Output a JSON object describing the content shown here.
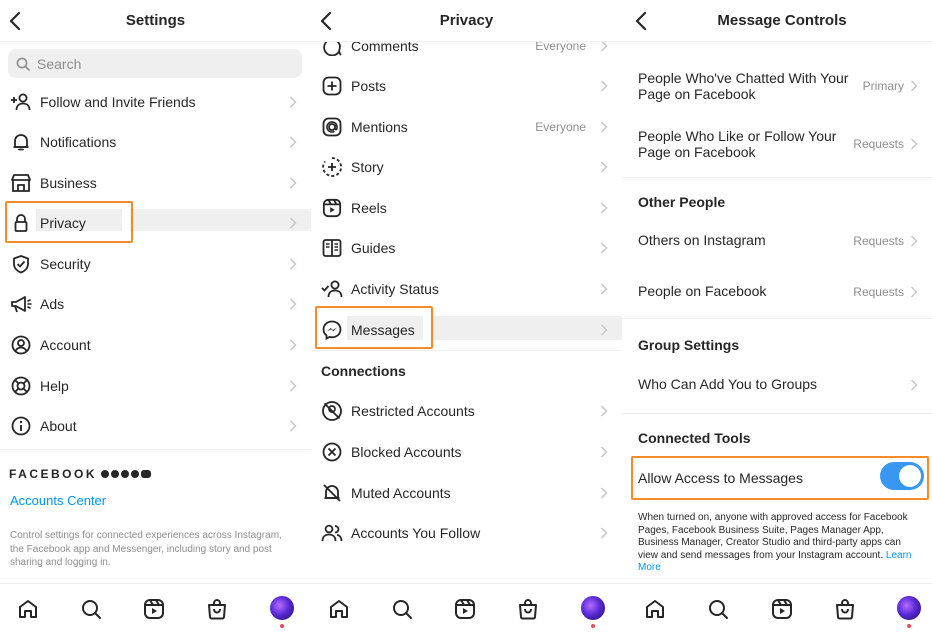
{
  "settings": {
    "title": "Settings",
    "search_placeholder": "Search",
    "items": [
      {
        "label": "Follow and Invite Friends",
        "icon": "add-person-icon"
      },
      {
        "label": "Notifications",
        "icon": "bell-icon"
      },
      {
        "label": "Business",
        "icon": "storefront-icon"
      },
      {
        "label": "Privacy",
        "icon": "lock-icon"
      },
      {
        "label": "Security",
        "icon": "shield-icon"
      },
      {
        "label": "Ads",
        "icon": "megaphone-icon"
      },
      {
        "label": "Account",
        "icon": "account-circle-icon"
      },
      {
        "label": "Help",
        "icon": "lifebuoy-icon"
      },
      {
        "label": "About",
        "icon": "info-icon"
      }
    ],
    "facebook_label": "FACEBOOK",
    "accounts_center": "Accounts Center",
    "note": "Control settings for connected experiences across Instagram, the Facebook app and Messenger, including story and post sharing and logging in."
  },
  "privacy": {
    "title": "Privacy",
    "items": [
      {
        "label": "Comments",
        "value": "Everyone",
        "icon": "comment-icon"
      },
      {
        "label": "Posts",
        "value": "",
        "icon": "plus-square-icon"
      },
      {
        "label": "Mentions",
        "value": "Everyone",
        "icon": "at-sign-icon"
      },
      {
        "label": "Story",
        "value": "",
        "icon": "story-plus-icon"
      },
      {
        "label": "Reels",
        "value": "",
        "icon": "reels-icon"
      },
      {
        "label": "Guides",
        "value": "",
        "icon": "guides-book-icon"
      },
      {
        "label": "Activity Status",
        "value": "",
        "icon": "activity-status-icon"
      },
      {
        "label": "Messages",
        "value": "",
        "icon": "messenger-icon"
      }
    ],
    "connections_title": "Connections",
    "connections": [
      {
        "label": "Restricted Accounts",
        "icon": "restricted-icon"
      },
      {
        "label": "Blocked Accounts",
        "icon": "blocked-icon"
      },
      {
        "label": "Muted Accounts",
        "icon": "muted-bell-icon"
      },
      {
        "label": "Accounts You Follow",
        "icon": "people-icon"
      }
    ]
  },
  "message_controls": {
    "title": "Message Controls",
    "rows": [
      {
        "label": "People Who've Chatted With Your Page on Facebook",
        "value": "Primary"
      },
      {
        "label": "People Who Like or Follow Your Page on Facebook",
        "value": "Requests"
      }
    ],
    "other_people_title": "Other People",
    "other_people": [
      {
        "label": "Others on Instagram",
        "value": "Requests"
      },
      {
        "label": "People on Facebook",
        "value": "Requests"
      }
    ],
    "group_settings_title": "Group Settings",
    "group_row": "Who Can Add You to Groups",
    "connected_tools_title": "Connected Tools",
    "allow_access_label": "Allow Access to Messages",
    "allow_access_on": true,
    "note": "When turned on, anyone with approved access for Facebook Pages, Facebook Business Suite, Pages Manager App, Business Manager, Creator Studio and third-party apps can view and send messages from your Instagram account.",
    "learn_more": "Learn More"
  },
  "tabbar": [
    "home-icon",
    "search-icon",
    "reels-icon",
    "shop-icon",
    "profile-avatar"
  ],
  "colors": {
    "highlight": "#f28c28",
    "link": "#0095f6",
    "toggle": "#3897f0",
    "badge": "#ed4956"
  }
}
